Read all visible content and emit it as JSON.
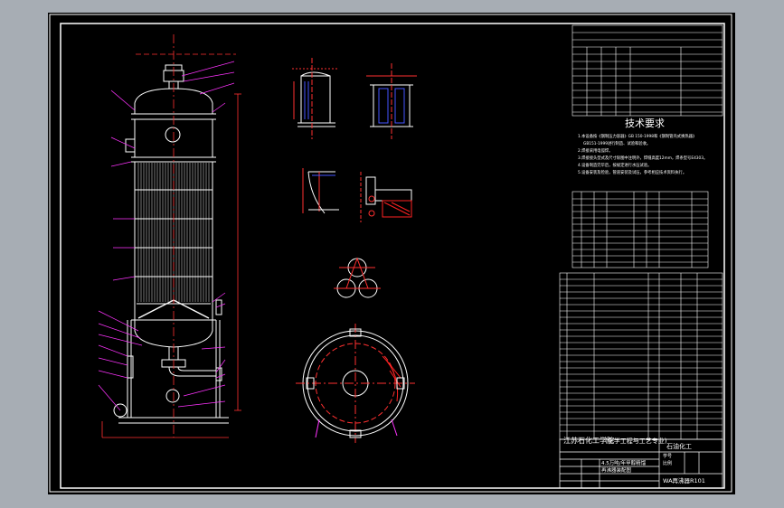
{
  "drawing": {
    "tech_title": "技术要求",
    "notes": [
      "1.本设备按《钢制压力容器》GB 150-1998和《钢制管壳式换热器》",
      "GB151-1999进行制造、试验和验收。",
      "2.焊接采用电弧焊。",
      "3.焊接接头型式及尺寸除图中注明外，焊缝高度12mm，焊条型号E4303。",
      "4.设备制造完毕后，按规定进行水压试验。",
      "5.设备安装及检验，管道安装及试压，参考相应技术资料执行。"
    ],
    "title_block": {
      "school": "江苏石化工学院",
      "department": "(化学工程与工艺专业)",
      "company": "石油化工",
      "design_name": "4.5万吨/年甲醇精馏",
      "drawing_name": "再沸器装配图",
      "unit_label": "学号",
      "scale_label": "比例",
      "number": "WA再沸器R101"
    },
    "colors": {
      "background": "#000000",
      "frame": "#ffffff",
      "vessel": "#ffffff",
      "tubes": "#c9c9c9",
      "leader": "#ff33ff",
      "dimension": "#ff3030",
      "nozzle_label": "#00ff66",
      "detail_blue": "#4455ff",
      "hatch": "#ff2222",
      "center_line": "#ff3030"
    }
  }
}
